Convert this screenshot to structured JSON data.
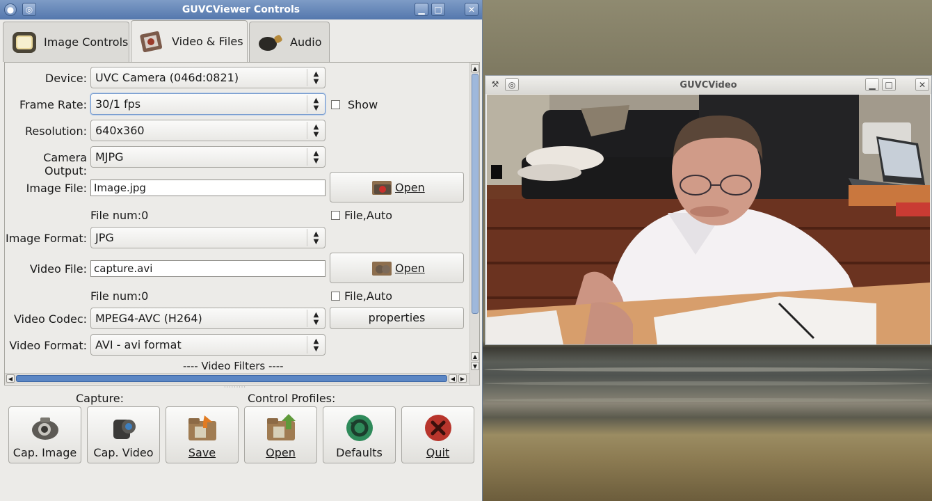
{
  "controls_window": {
    "title": "GUVCViewer Controls",
    "tabs": [
      {
        "label": "Image Controls",
        "icon": "monitor-icon"
      },
      {
        "label": "Video & Files",
        "icon": "video-files-icon",
        "active": true
      },
      {
        "label": "Audio",
        "icon": "microphone-icon"
      }
    ],
    "video_tab": {
      "device_label": "Device:",
      "device_value": "UVC Camera (046d:0821)",
      "frame_rate_label": "Frame Rate:",
      "frame_rate_value": "30/1 fps",
      "show_label": "Show",
      "resolution_label": "Resolution:",
      "resolution_value": "640x360",
      "camera_output_label": "Camera Output:",
      "camera_output_value": "MJPG",
      "image_file_label": "Image File:",
      "image_file_value": "Image.jpg",
      "image_open_label": "Open",
      "image_file_num": "File num:0",
      "image_file_auto_label": "File,Auto",
      "image_format_label": "Image Format:",
      "image_format_value": "JPG",
      "video_file_label": "Video File:",
      "video_file_value": "capture.avi",
      "video_open_label": "Open",
      "video_file_num": "File num:0",
      "video_file_auto_label": "File,Auto",
      "video_codec_label": "Video Codec:",
      "video_codec_value": "MPEG4-AVC (H264)",
      "properties_label": "properties",
      "video_format_label": "Video Format:",
      "video_format_value": "AVI - avi format",
      "video_filters_label": "---- Video Filters ----"
    },
    "capture_label": "Capture:",
    "profiles_label": "Control Profiles:",
    "buttons": {
      "cap_image": "Cap. Image",
      "cap_video": "Cap. Video",
      "save": "Save",
      "open": "Open",
      "defaults": "Defaults",
      "quit": "Quit"
    }
  },
  "video_window": {
    "title": "GUVCVideo"
  },
  "colors": {
    "titlebar": "#5477ad",
    "scroll_thumb": "#5b86c4",
    "window_bg": "#ecebe8"
  }
}
